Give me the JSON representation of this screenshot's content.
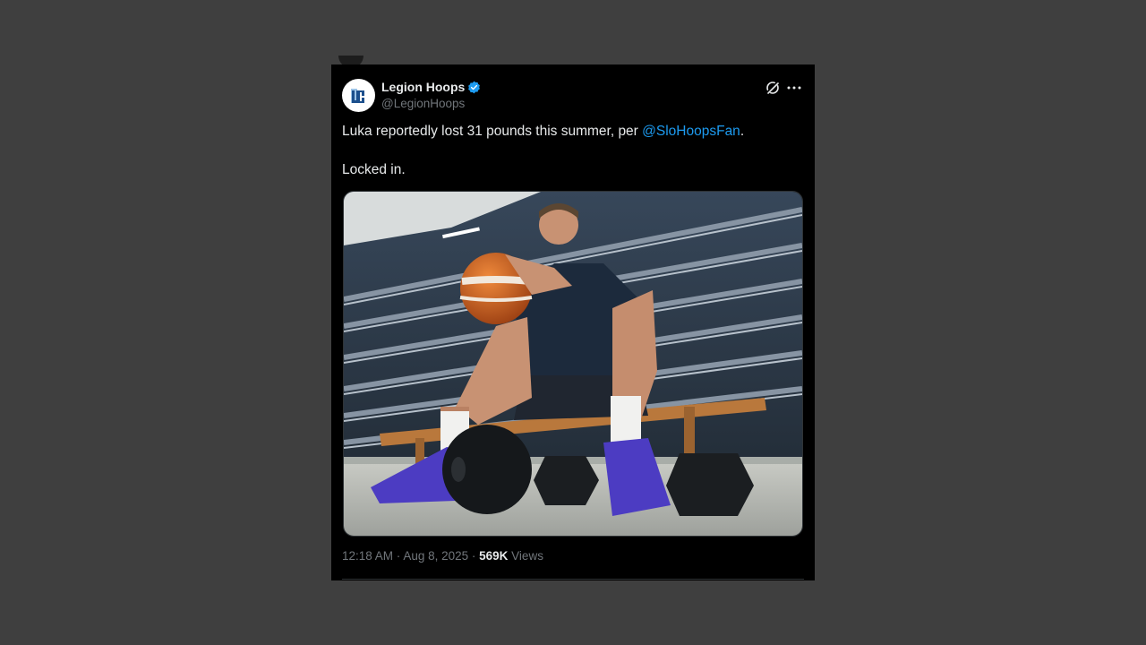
{
  "author": {
    "display_name": "Legion Hoops",
    "handle": "@LegionHoops",
    "verified": true,
    "verified_color": "#1d9bf0"
  },
  "tweet": {
    "text_before_mention": "Luka reportedly lost 31 pounds this summer, per ",
    "mention": "@SloHoopsFan",
    "text_after_mention": ".",
    "line2": "Locked in."
  },
  "meta": {
    "time": "12:18 AM",
    "sep1": " · ",
    "date": "Aug 8, 2025",
    "sep2": " · ",
    "views_count": "569K",
    "views_label": " Views"
  },
  "icons": {
    "grok": "grok-icon",
    "more": "more-icon",
    "verified": "verified-badge-icon",
    "avatar": "legion-hoops-logo"
  },
  "colors": {
    "background": "#3f3f3f",
    "tweet_bg": "#000000",
    "text": "#e7e9ea",
    "muted": "#71767b",
    "link": "#1d9bf0"
  }
}
